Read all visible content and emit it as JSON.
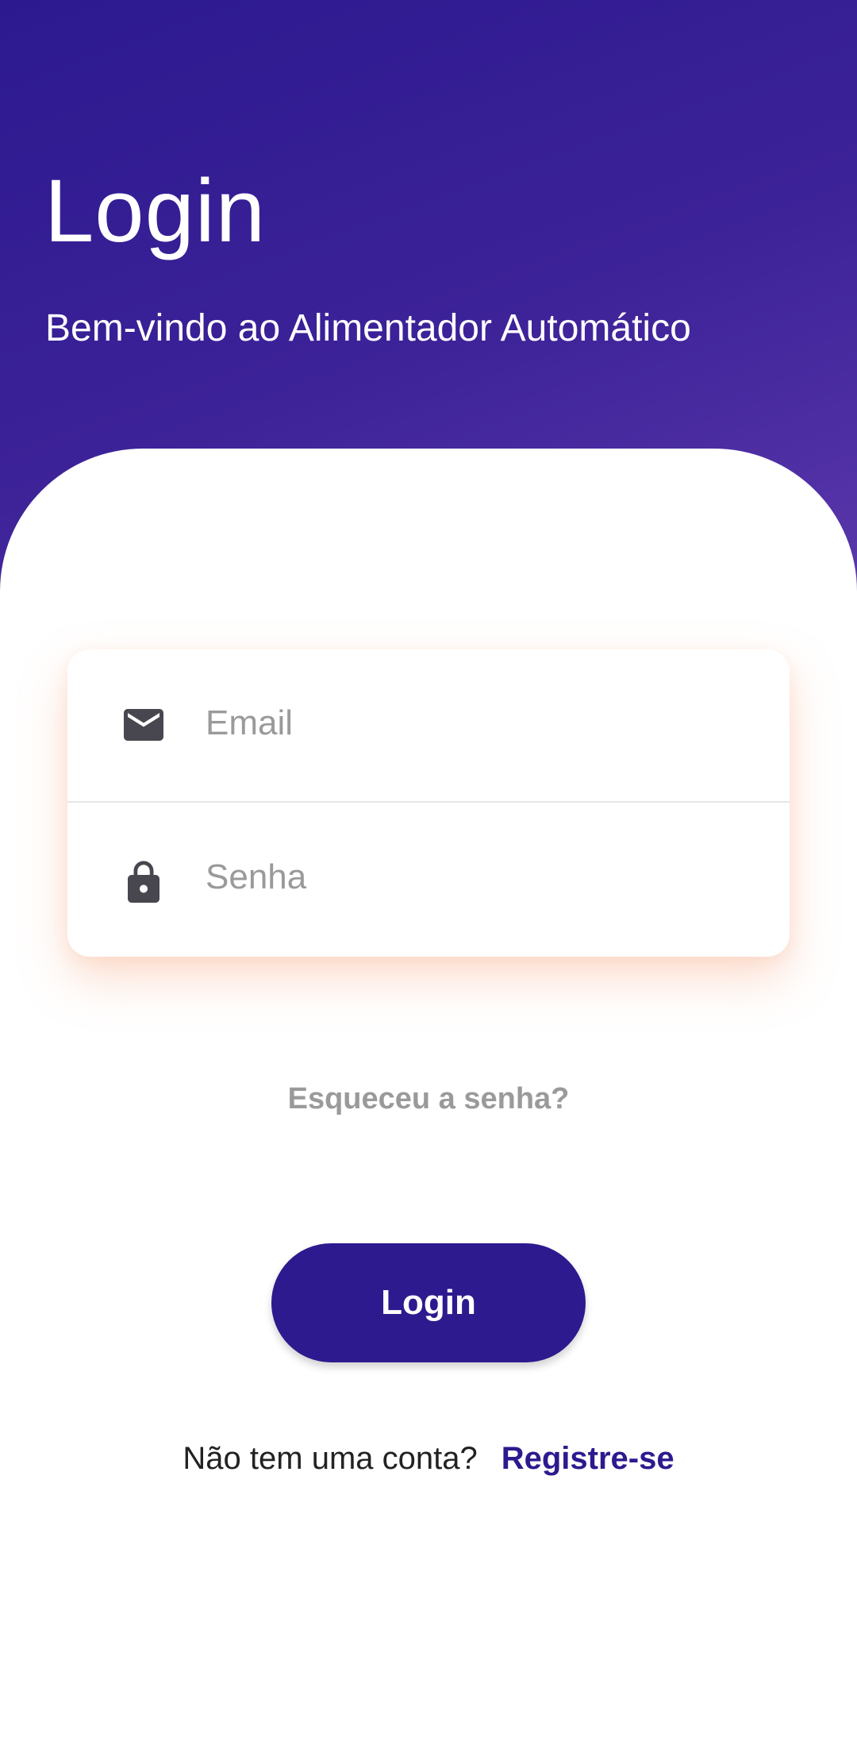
{
  "header": {
    "title": "Login",
    "subtitle": "Bem-vindo ao Alimentador Automático"
  },
  "form": {
    "email": {
      "placeholder": "Email",
      "value": "",
      "icon": "mail-icon"
    },
    "password": {
      "placeholder": "Senha",
      "value": "",
      "icon": "lock-icon"
    }
  },
  "forgot_password": "Esqueceu a senha?",
  "login_button": "Login",
  "signup": {
    "prompt": "Não tem uma conta?",
    "link": "Registre-se"
  },
  "colors": {
    "primary": "#2d1a8e",
    "gradient_start": "#2c1990",
    "gradient_end": "#5a38ab",
    "card_shadow": "#f6a078",
    "muted_text": "#9a9a9a"
  }
}
